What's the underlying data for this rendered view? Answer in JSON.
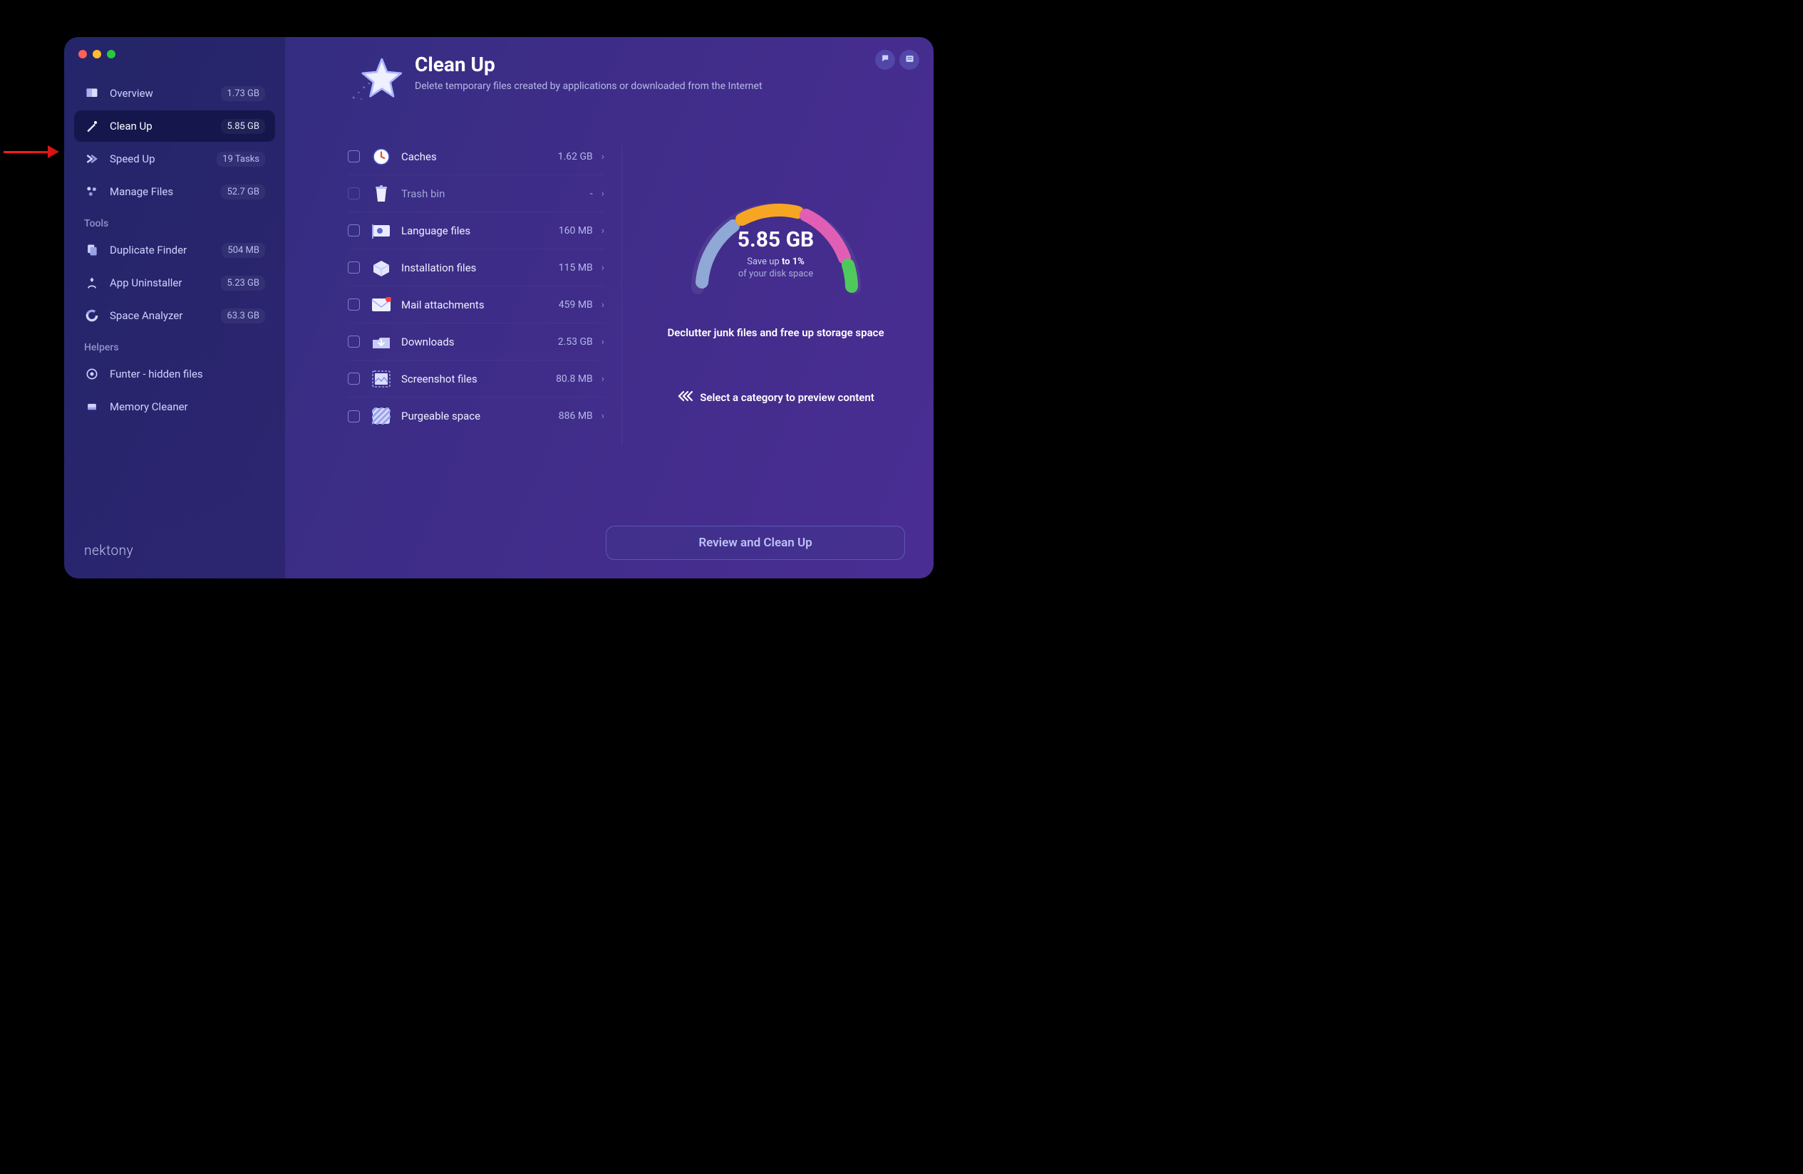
{
  "sidebar": {
    "main": [
      {
        "id": "overview",
        "label": "Overview",
        "badge": "1.73 GB",
        "icon": "gauge"
      },
      {
        "id": "cleanup",
        "label": "Clean Up",
        "badge": "5.85 GB",
        "icon": "wand",
        "active": true
      },
      {
        "id": "speedup",
        "label": "Speed Up",
        "badge": "19 Tasks",
        "icon": "chevrons"
      },
      {
        "id": "managefiles",
        "label": "Manage Files",
        "badge": "52.7 GB",
        "icon": "grid"
      }
    ],
    "tools_header": "Tools",
    "tools": [
      {
        "id": "dup",
        "label": "Duplicate Finder",
        "badge": "504 MB",
        "icon": "copy"
      },
      {
        "id": "uninst",
        "label": "App Uninstaller",
        "badge": "5.23 GB",
        "icon": "person"
      },
      {
        "id": "space",
        "label": "Space Analyzer",
        "badge": "63.3 GB",
        "icon": "pie"
      }
    ],
    "helpers_header": "Helpers",
    "helpers": [
      {
        "id": "funter",
        "label": "Funter - hidden files",
        "icon": "target"
      },
      {
        "id": "mem",
        "label": "Memory Cleaner",
        "icon": "chip"
      }
    ],
    "brand": "nektony"
  },
  "header": {
    "title": "Clean Up",
    "subtitle": "Delete temporary files created by applications or downloaded from the Internet"
  },
  "categories": [
    {
      "id": "caches",
      "label": "Caches",
      "size": "1.62 GB",
      "icon": "clock"
    },
    {
      "id": "trash",
      "label": "Trash bin",
      "size": "-",
      "icon": "trash",
      "dim": true
    },
    {
      "id": "lang",
      "label": "Language files",
      "size": "160 MB",
      "icon": "flag"
    },
    {
      "id": "install",
      "label": "Installation files",
      "size": "115 MB",
      "icon": "box"
    },
    {
      "id": "mail",
      "label": "Mail attachments",
      "size": "459 MB",
      "icon": "mail"
    },
    {
      "id": "downloads",
      "label": "Downloads",
      "size": "2.53 GB",
      "icon": "download"
    },
    {
      "id": "screenshot",
      "label": "Screenshot files",
      "size": "80.8 MB",
      "icon": "image"
    },
    {
      "id": "purgeable",
      "label": "Purgeable space",
      "size": "886 MB",
      "icon": "stripes"
    }
  ],
  "gauge": {
    "total": "5.85 GB",
    "save_prefix": "Save up ",
    "save_bold": "to 1%",
    "line2": "of your disk space",
    "message": "Declutter junk files and free up storage space",
    "hint": "Select a category to preview content",
    "segments": [
      {
        "color": "#8fa8d6"
      },
      {
        "color": "#f6a623"
      },
      {
        "color": "#e05fb4"
      },
      {
        "color": "#4fc95c"
      }
    ]
  },
  "action": {
    "review_label": "Review and Clean Up"
  },
  "colors": {
    "accent": "#7c86ff"
  }
}
